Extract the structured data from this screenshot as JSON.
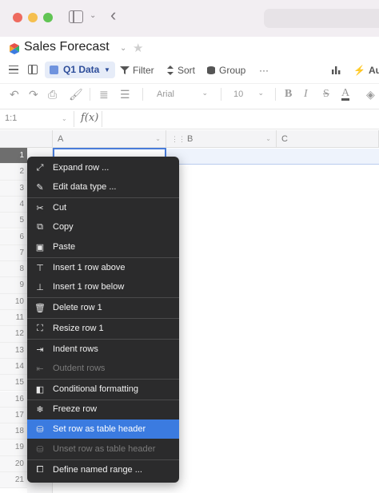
{
  "window": {
    "icons": [
      "sidebar-icon",
      "chevron-down-icon",
      "back-icon"
    ]
  },
  "doc": {
    "title": "Sales Forecast"
  },
  "toolbar": {
    "view_label": "Q1 Data",
    "filter_label": "Filter",
    "sort_label": "Sort",
    "group_label": "Group",
    "more_label": "···",
    "auto_label": "Aut"
  },
  "format": {
    "font": "Arial",
    "size": "10"
  },
  "formula": {
    "cell_ref": "1:1",
    "fx_label": "f(x)"
  },
  "grid": {
    "columns": [
      "A",
      "B",
      "C"
    ],
    "rows": [
      "1",
      "2",
      "3",
      "4",
      "5",
      "6",
      "7",
      "8",
      "9",
      "10",
      "11",
      "12",
      "13",
      "14",
      "15",
      "16",
      "17",
      "18",
      "19",
      "20",
      "21"
    ],
    "selected_row": "1"
  },
  "menu": {
    "items": [
      {
        "label": "Expand row ...",
        "icon": "expand-icon",
        "disabled": false
      },
      {
        "label": "Edit data type ...",
        "icon": "edit-icon",
        "disabled": false
      },
      {
        "label": "Cut",
        "icon": "scissors-icon",
        "disabled": false
      },
      {
        "label": "Copy",
        "icon": "copy-icon",
        "disabled": false
      },
      {
        "label": "Paste",
        "icon": "clipboard-icon",
        "disabled": false
      },
      {
        "label": "Insert 1 row above",
        "icon": "insert-above-icon",
        "disabled": false
      },
      {
        "label": "Insert 1 row below",
        "icon": "insert-below-icon",
        "disabled": false
      },
      {
        "label": "Delete row 1",
        "icon": "trash-icon",
        "disabled": false
      },
      {
        "label": "Resize row 1",
        "icon": "resize-icon",
        "disabled": false
      },
      {
        "label": "Indent rows",
        "icon": "indent-icon",
        "disabled": false
      },
      {
        "label": "Outdent rows",
        "icon": "outdent-icon",
        "disabled": true
      },
      {
        "label": "Conditional formatting",
        "icon": "conditional-format-icon",
        "disabled": false
      },
      {
        "label": "Freeze row",
        "icon": "snowflake-icon",
        "disabled": false
      },
      {
        "label": "Set row as table header",
        "icon": "database-icon",
        "disabled": false,
        "highlighted": true
      },
      {
        "label": "Unset row as table header",
        "icon": "database-icon",
        "disabled": true
      },
      {
        "label": "Define named range ...",
        "icon": "named-range-icon",
        "disabled": false
      }
    ]
  }
}
